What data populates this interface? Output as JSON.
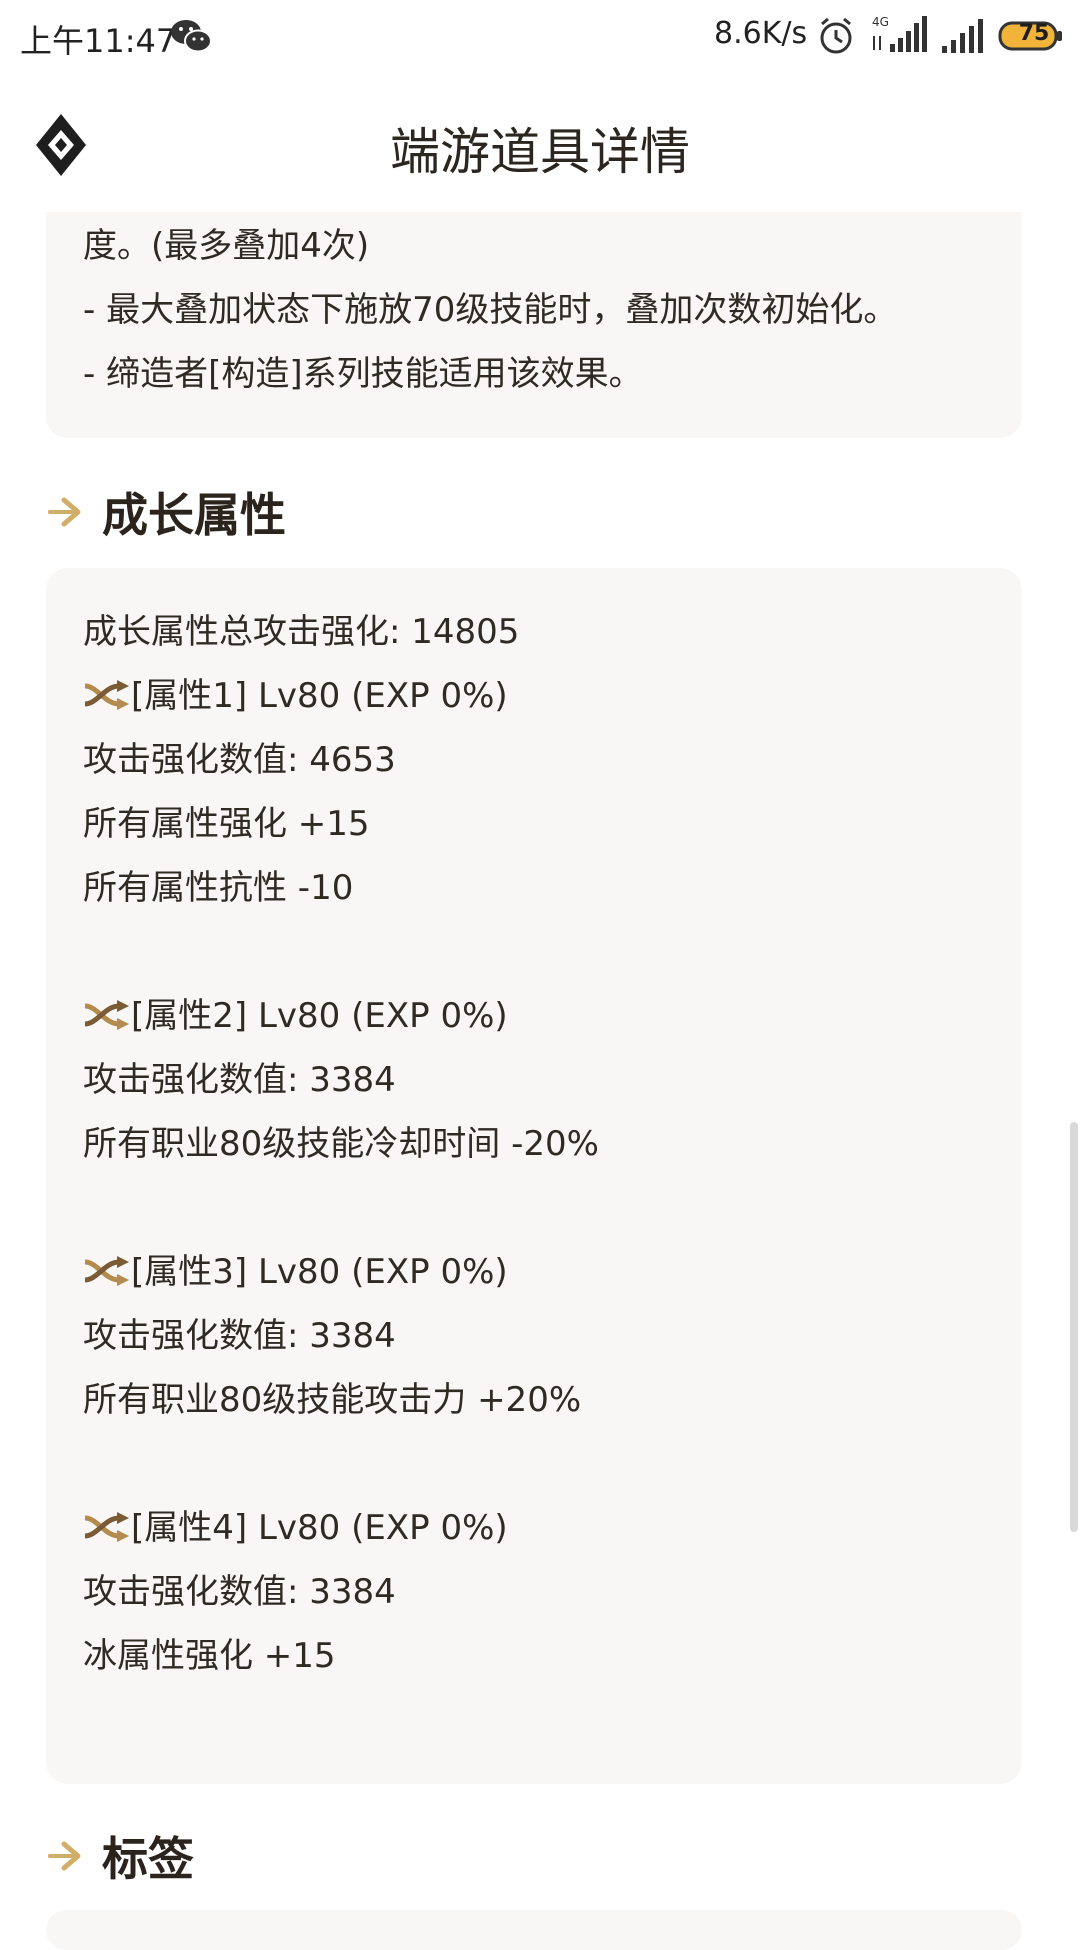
{
  "status_bar": {
    "time": "上午11:47",
    "net_speed": "8.6K/s",
    "battery": "75",
    "network_type": "4G"
  },
  "header": {
    "title": "端游道具详情"
  },
  "description_tail": [
    "度。(最多叠加4次)",
    "- 最大叠加状态下施放70级技能时，叠加次数初始化。",
    "- 缔造者[构造]系列技能适用该效果。"
  ],
  "growth_section": {
    "title": "成长属性",
    "total": "成长属性总攻击强化: 14805",
    "attributes": [
      {
        "header": "[属性1] Lv80 (EXP 0%)",
        "lines": [
          "攻击强化数值: 4653",
          "所有属性强化 +15",
          "所有属性抗性 -10"
        ]
      },
      {
        "header": "[属性2] Lv80 (EXP 0%)",
        "lines": [
          "攻击强化数值: 3384",
          "所有职业80级技能冷却时间 -20%"
        ]
      },
      {
        "header": "[属性3] Lv80 (EXP 0%)",
        "lines": [
          "攻击强化数值: 3384",
          "所有职业80级技能攻击力 +20%"
        ]
      },
      {
        "header": "[属性4] Lv80 (EXP 0%)",
        "lines": [
          "攻击强化数值: 3384",
          "冰属性强化 +15"
        ]
      }
    ]
  },
  "tags_section": {
    "title": "标签"
  },
  "colors": {
    "accent_gold": "#c8a25c",
    "card_bg": "#f8f7f6",
    "text": "#2f2a24"
  },
  "icons": {
    "attribute_icon": "shuffle-icon",
    "section_icon": "arrow-right-icon",
    "logo": "diamond-logo-icon"
  }
}
